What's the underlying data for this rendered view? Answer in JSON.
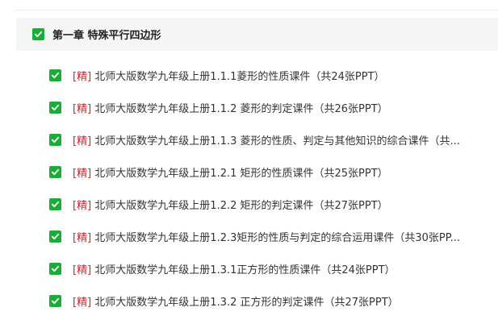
{
  "chapter": {
    "checked": true,
    "title": "第一章 特殊平行四边形"
  },
  "accent_color": "#1aad3a",
  "tag_color": "#d32222",
  "items": [
    {
      "checked": true,
      "tag": "[精]",
      "title": "北师大版数学九年级上册1.1.1菱形的性质课件（共24张PPT）"
    },
    {
      "checked": true,
      "tag": "[精]",
      "title": "北师大版数学九年级上册1.1.2 菱形的判定课件（共26张PPT）"
    },
    {
      "checked": true,
      "tag": "[精]",
      "title": "北师大版数学九年级上册1.1.3 菱形的性质、判定与其他知识的综合课件（共..."
    },
    {
      "checked": true,
      "tag": "[精]",
      "title": "北师大版数学九年级上册1.2.1 矩形的性质课件（共25张PPT）"
    },
    {
      "checked": true,
      "tag": "[精]",
      "title": "北师大版数学九年级上册1.2.2 矩形的判定课件（共27张PPT）"
    },
    {
      "checked": true,
      "tag": "[精]",
      "title": "北师大版数学九年级上册1.2.3矩形的性质与判定的综合运用课件（共30张PP..."
    },
    {
      "checked": true,
      "tag": "[精]",
      "title": "北师大版数学九年级上册1.3.1正方形的性质课件（共24张PPT）"
    },
    {
      "checked": true,
      "tag": "[精]",
      "title": "北师大版数学九年级上册1.3.2 正方形的判定课件（共27张PPT）"
    }
  ]
}
